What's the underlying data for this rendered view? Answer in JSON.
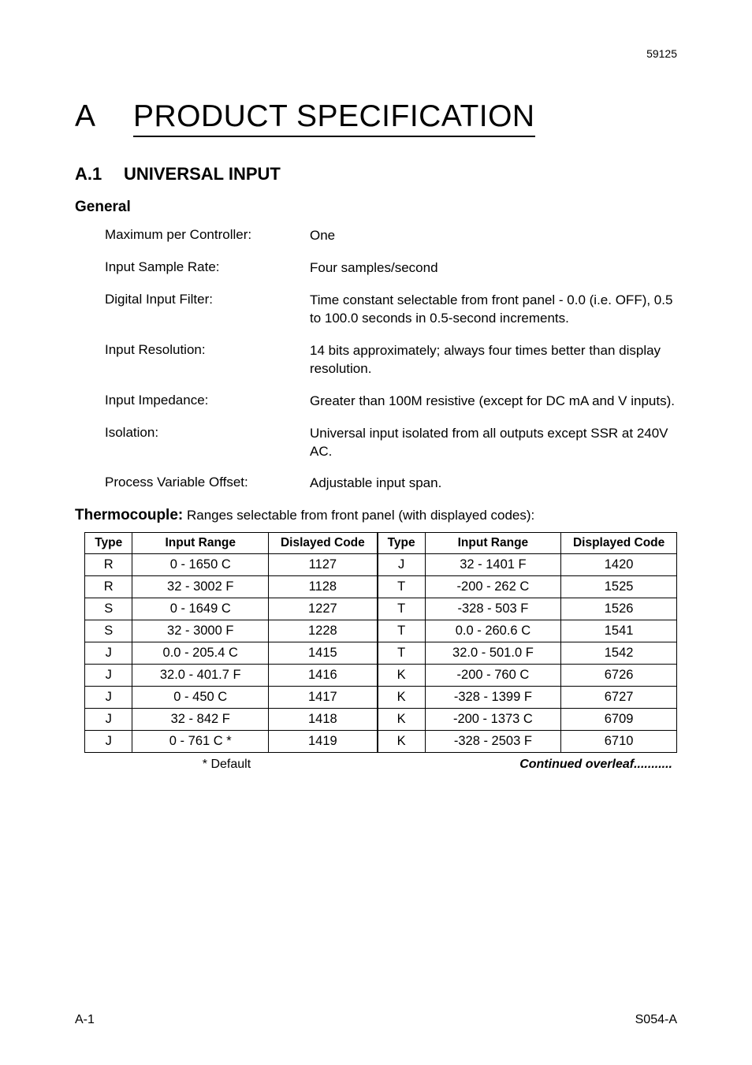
{
  "header_number": "59125",
  "h1_letter": "A",
  "h1_title": "PRODUCT SPECIFICATION",
  "h2_num": "A.1",
  "h2_title": "UNIVERSAL INPUT",
  "h3_general": "General",
  "specs": [
    {
      "label": "Maximum per Controller:",
      "value": "One"
    },
    {
      "label": "Input Sample Rate:",
      "value": "Four samples/second"
    },
    {
      "label": "Digital Input Filter:",
      "value": "Time constant selectable from front panel - 0.0 (i.e. OFF), 0.5 to 100.0 seconds in 0.5-second increments."
    },
    {
      "label": "Input Resolution:",
      "value": "14 bits approximately; always four times better than display resolution."
    },
    {
      "label": "Input Impedance:",
      "value": "Greater than 100M   resistive (except for DC mA and V inputs)."
    },
    {
      "label": "Isolation:",
      "value": "Universal input isolated from all outputs except SSR at 240V AC."
    },
    {
      "label": "Process Variable Offset:",
      "value": "Adjustable   input span."
    }
  ],
  "thermo_label": "Thermocouple:",
  "thermo_desc": " Ranges selectable from front panel (with displayed codes):",
  "table": {
    "headers": [
      "Type",
      "Input Range",
      "Dislayed Code",
      "Type",
      "Input Range",
      "Displayed Code"
    ],
    "rows": [
      [
        "R",
        "0 - 1650  C",
        "1127",
        "J",
        "32 - 1401  F",
        "1420"
      ],
      [
        "R",
        "32 - 3002  F",
        "1128",
        "T",
        "-200 - 262  C",
        "1525"
      ],
      [
        "S",
        "0 - 1649  C",
        "1227",
        "T",
        "-328 - 503  F",
        "1526"
      ],
      [
        "S",
        "32 - 3000  F",
        "1228",
        "T",
        "0.0 - 260.6  C",
        "1541"
      ],
      [
        "J",
        "0.0 - 205.4  C",
        "1415",
        "T",
        "32.0 - 501.0  F",
        "1542"
      ],
      [
        "J",
        "32.0 - 401.7  F",
        "1416",
        "K",
        "-200 - 760  C",
        "6726"
      ],
      [
        "J",
        "0 - 450  C",
        "1417",
        "K",
        "-328 - 1399  F",
        "6727"
      ],
      [
        "J",
        "32 - 842  F",
        "1418",
        "K",
        "-200 - 1373  C",
        "6709"
      ],
      [
        "J",
        "0 - 761  C *",
        "1419",
        "K",
        "-328 - 2503  F",
        "6710"
      ]
    ]
  },
  "footnote_default": "* Default",
  "footnote_continued": "Continued overleaf...........",
  "footer_left": "A-1",
  "footer_right": "S054-A"
}
